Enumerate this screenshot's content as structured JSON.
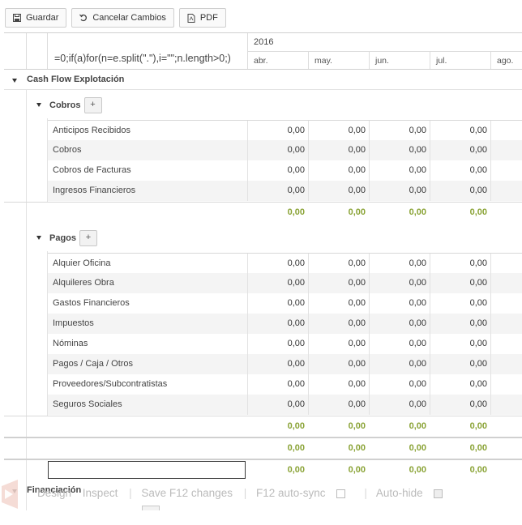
{
  "toolbar": {
    "save_label": "Guardar",
    "cancel_label": "Cancelar Cambios",
    "pdf_label": "PDF"
  },
  "header": {
    "formula": "=0;if(a)for(n=e.split(\".\"),i=\"\";n.length>0;)",
    "year": "2016",
    "months": [
      "abr.",
      "may.",
      "jun.",
      "jul.",
      "ago."
    ]
  },
  "sections": {
    "explotacion": "Cash Flow Explotación",
    "cobros": "Cobros",
    "pagos": "Pagos",
    "financiacion": "Financiación",
    "add_label": "+"
  },
  "cobros_rows": [
    {
      "name": "Anticipos Recibidos",
      "values": [
        "0,00",
        "0,00",
        "0,00",
        "0,00"
      ]
    },
    {
      "name": "Cobros",
      "values": [
        "0,00",
        "0,00",
        "0,00",
        "0,00"
      ]
    },
    {
      "name": "Cobros de Facturas",
      "values": [
        "0,00",
        "0,00",
        "0,00",
        "0,00"
      ]
    },
    {
      "name": "Ingresos Financieros",
      "values": [
        "0,00",
        "0,00",
        "0,00",
        "0,00"
      ]
    }
  ],
  "cobros_total": [
    "0,00",
    "0,00",
    "0,00",
    "0,00"
  ],
  "pagos_rows": [
    {
      "name": "Alquier Oficina",
      "values": [
        "0,00",
        "0,00",
        "0,00",
        "0,00"
      ]
    },
    {
      "name": "Alquileres Obra",
      "values": [
        "0,00",
        "0,00",
        "0,00",
        "0,00"
      ]
    },
    {
      "name": "Gastos Financieros",
      "values": [
        "0,00",
        "0,00",
        "0,00",
        "0,00"
      ]
    },
    {
      "name": "Impuestos",
      "values": [
        "0,00",
        "0,00",
        "0,00",
        "0,00"
      ]
    },
    {
      "name": "Nóminas",
      "values": [
        "0,00",
        "0,00",
        "0,00",
        "0,00"
      ]
    },
    {
      "name": "Pagos / Caja / Otros",
      "values": [
        "0,00",
        "0,00",
        "0,00",
        "0,00"
      ]
    },
    {
      "name": "Proveedores/Subcontratistas",
      "values": [
        "0,00",
        "0,00",
        "0,00",
        "0,00"
      ]
    },
    {
      "name": "Seguros Sociales",
      "values": [
        "0,00",
        "0,00",
        "0,00",
        "0,00"
      ]
    }
  ],
  "pagos_total": [
    "0,00",
    "0,00",
    "0,00",
    "0,00"
  ],
  "explotacion_total": [
    "0,00",
    "0,00",
    "0,00",
    "0,00"
  ],
  "edit_row_total": [
    "0,00",
    "0,00",
    "0,00",
    "0,00"
  ],
  "devtools": {
    "design": "Design",
    "inspect": "Inspect",
    "save": "Save F12 changes",
    "autosync": "F12 auto-sync",
    "autohide": "Auto-hide"
  },
  "colors": {
    "accent": "#8aa336",
    "alt_row": "#f4f4f4"
  }
}
